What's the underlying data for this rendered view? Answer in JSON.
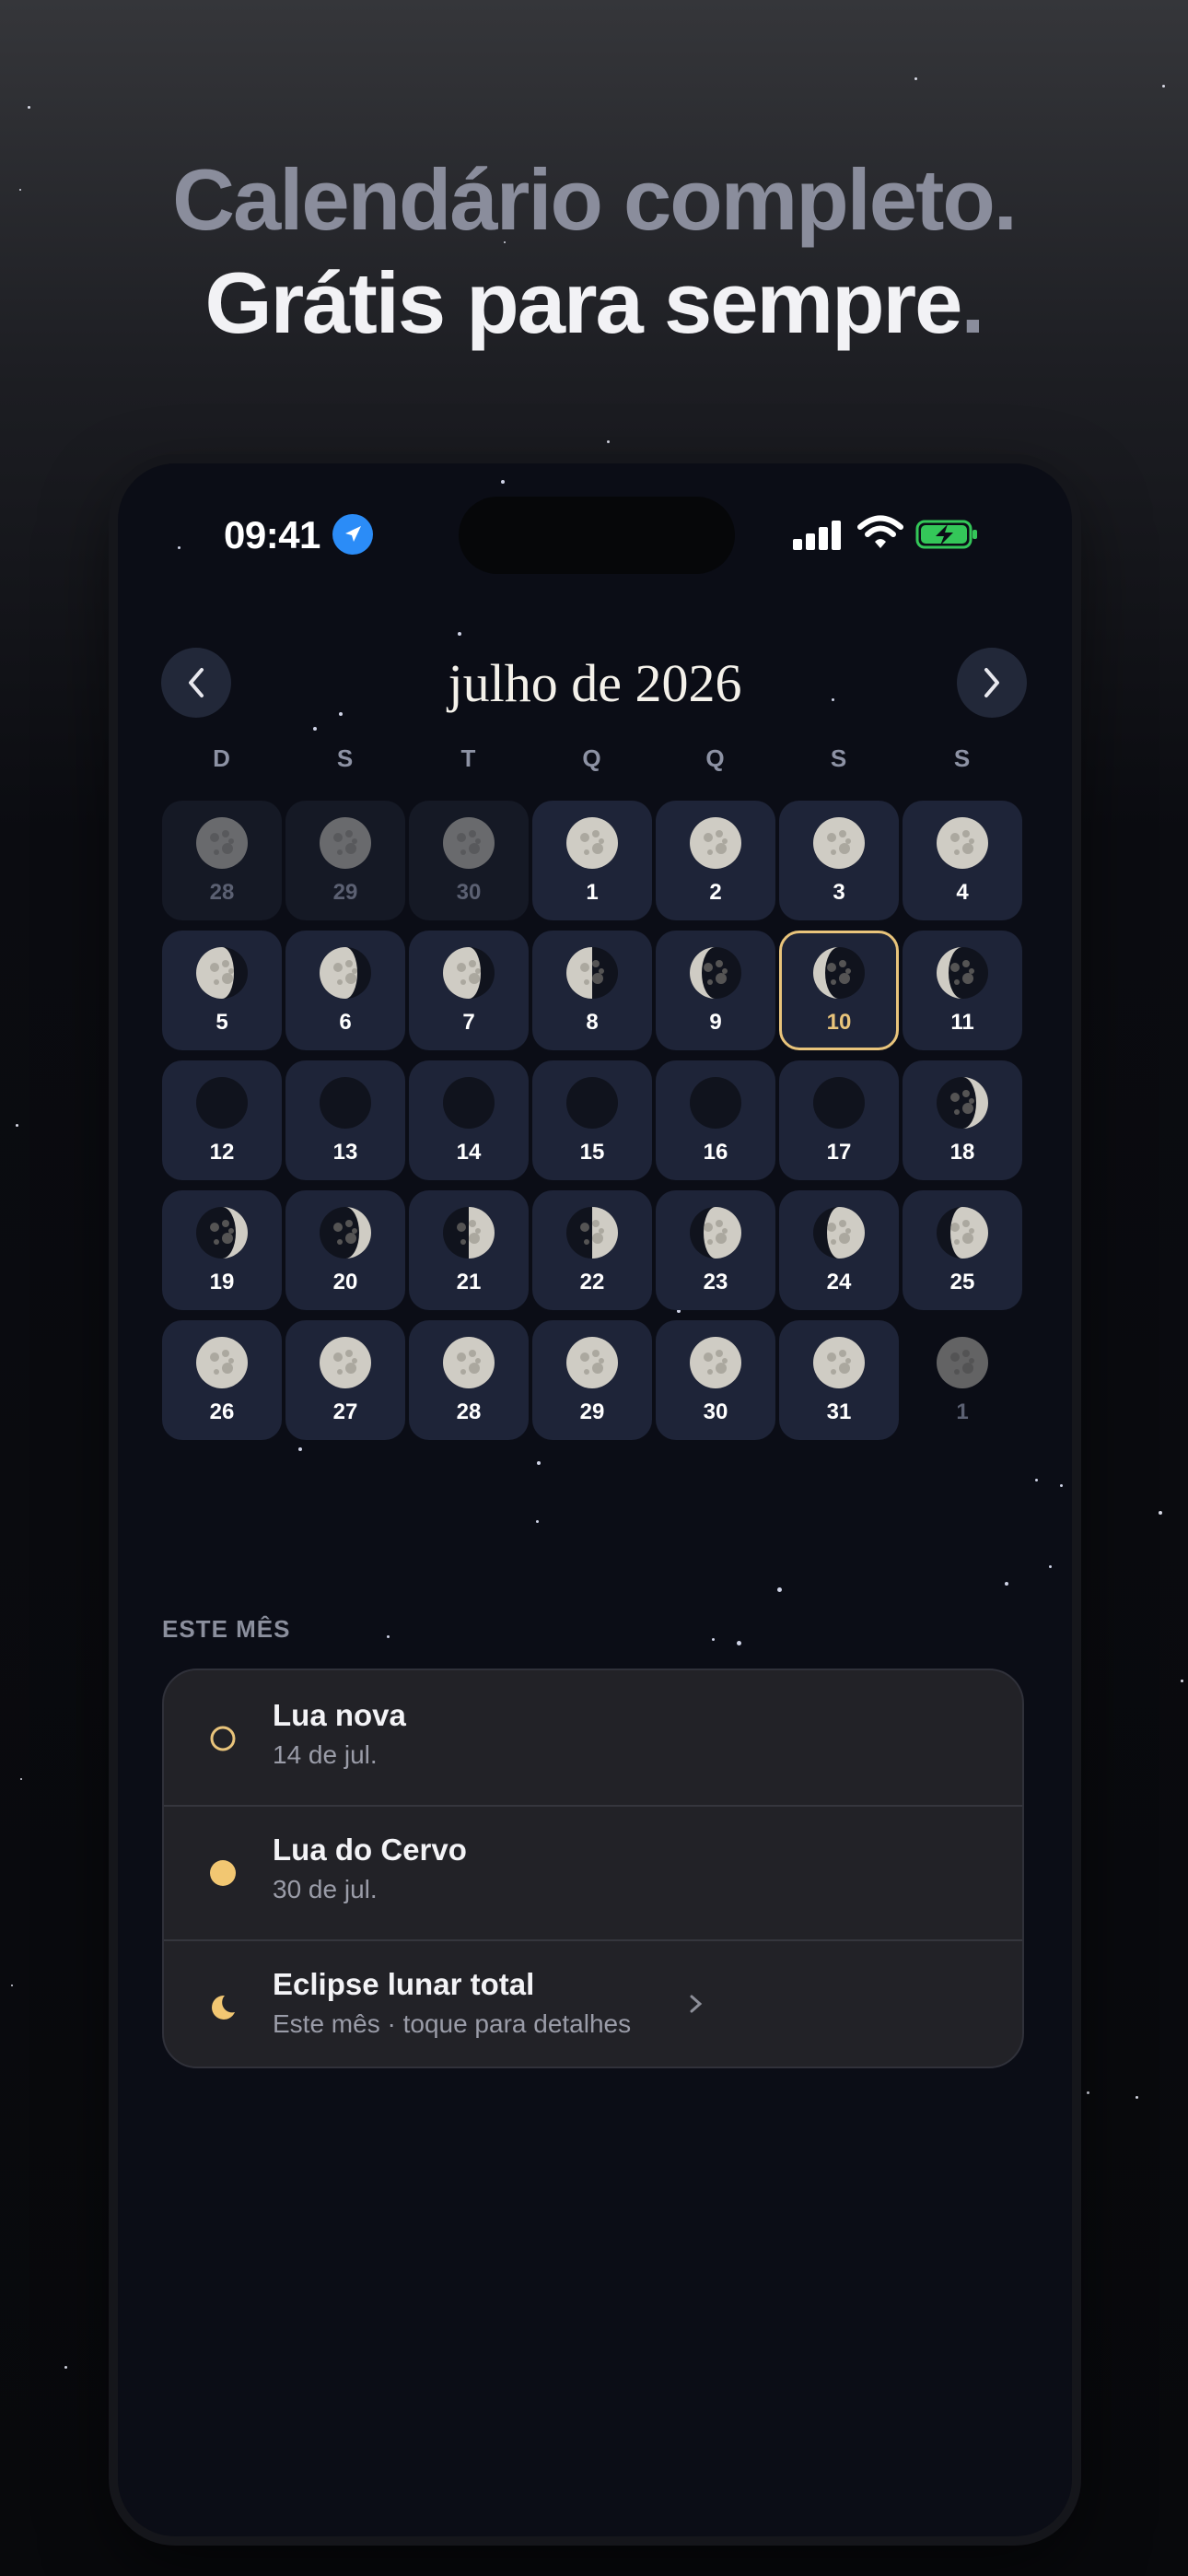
{
  "headline": {
    "line1": "Calendário completo.",
    "line2_main": "Grátis para sempre",
    "line2_dot": "."
  },
  "status_bar": {
    "time": "09:41"
  },
  "calendar": {
    "month_title": "julho de 2026",
    "weekdays": [
      "D",
      "S",
      "T",
      "Q",
      "Q",
      "S",
      "S"
    ],
    "weeks": [
      [
        {
          "day": "28",
          "phase": "full",
          "muted": true
        },
        {
          "day": "29",
          "phase": "full",
          "muted": true
        },
        {
          "day": "30",
          "phase": "full",
          "muted": true
        },
        {
          "day": "1",
          "phase": "full"
        },
        {
          "day": "2",
          "phase": "full"
        },
        {
          "day": "3",
          "phase": "full"
        },
        {
          "day": "4",
          "phase": "full"
        }
      ],
      [
        {
          "day": "5",
          "phase": "waning-gibbous"
        },
        {
          "day": "6",
          "phase": "waning-gibbous"
        },
        {
          "day": "7",
          "phase": "waning-gibbous"
        },
        {
          "day": "8",
          "phase": "last-quarter"
        },
        {
          "day": "9",
          "phase": "waning-crescent"
        },
        {
          "day": "10",
          "phase": "waning-crescent",
          "today": true
        },
        {
          "day": "11",
          "phase": "waning-crescent"
        }
      ],
      [
        {
          "day": "12",
          "phase": "new"
        },
        {
          "day": "13",
          "phase": "new"
        },
        {
          "day": "14",
          "phase": "new"
        },
        {
          "day": "15",
          "phase": "new"
        },
        {
          "day": "16",
          "phase": "new"
        },
        {
          "day": "17",
          "phase": "new"
        },
        {
          "day": "18",
          "phase": "waxing-crescent"
        }
      ],
      [
        {
          "day": "19",
          "phase": "waxing-crescent"
        },
        {
          "day": "20",
          "phase": "waxing-crescent"
        },
        {
          "day": "21",
          "phase": "first-quarter"
        },
        {
          "day": "22",
          "phase": "first-quarter"
        },
        {
          "day": "23",
          "phase": "waxing-gibbous"
        },
        {
          "day": "24",
          "phase": "waxing-gibbous"
        },
        {
          "day": "25",
          "phase": "waxing-gibbous"
        }
      ],
      [
        {
          "day": "26",
          "phase": "full"
        },
        {
          "day": "27",
          "phase": "full"
        },
        {
          "day": "28",
          "phase": "full"
        },
        {
          "day": "29",
          "phase": "full"
        },
        {
          "day": "30",
          "phase": "full"
        },
        {
          "day": "31",
          "phase": "full"
        },
        {
          "day": "1",
          "phase": "full",
          "muted": true,
          "blank": true
        }
      ]
    ]
  },
  "this_month": {
    "label": "ESTE MÊS",
    "events": [
      {
        "title": "Lua nova",
        "subtitle": "14 de jul.",
        "icon": "new-moon-outline-icon"
      },
      {
        "title": "Lua do Cervo",
        "subtitle": "30 de jul.",
        "icon": "full-moon-dot-icon"
      },
      {
        "title": "Eclipse lunar total",
        "subtitle": "Este mês · toque para detalhes",
        "icon": "crescent-moon-icon"
      }
    ]
  },
  "colors": {
    "accent_gold": "#e9c47b",
    "cell_bg": "#1e2438",
    "location_blue": "#2b8cf7",
    "battery_green": "#34c759"
  }
}
